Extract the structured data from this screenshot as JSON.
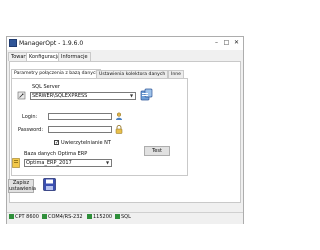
{
  "window": {
    "title": "ManagerOpt - 1.9.6.0"
  },
  "menu_tabs": [
    {
      "label": "Towary"
    },
    {
      "label": "Konfiguracja"
    },
    {
      "label": "Informacje"
    }
  ],
  "sub_tabs": [
    {
      "label": "Parametry połączenia z bazą danych"
    },
    {
      "label": "Ustawienia kolektora danych"
    },
    {
      "label": "Inne"
    }
  ],
  "sql_server": {
    "label": "SQL Server",
    "value": "SERWER\\SQLEXPRESS"
  },
  "login": {
    "label": "Login:",
    "value": ""
  },
  "password": {
    "label": "Password:",
    "value": ""
  },
  "trusted": {
    "label": "Uwierzytelnianie NT",
    "checked": true
  },
  "database": {
    "label": "Baza danych Optima ERP",
    "value": "Optima_ERP_2017"
  },
  "test_button": {
    "label": "Test"
  },
  "save_button": {
    "line1": "Zapisz",
    "line2": "ustawienia"
  },
  "status": [
    {
      "text": "CPT 8600",
      "icon": "device-icon",
      "color": "#2f8f3a"
    },
    {
      "text": "COM4/RS-232",
      "icon": "port-icon",
      "color": "#2f8f3a"
    },
    {
      "text": "115200",
      "icon": "baud-icon",
      "color": "#2f8f3a"
    },
    {
      "text": "SQL",
      "icon": "database-icon",
      "color": "#2f8f3a"
    }
  ],
  "colors": {
    "accent": "#2f5597",
    "status_ok": "#2f8f3a"
  }
}
